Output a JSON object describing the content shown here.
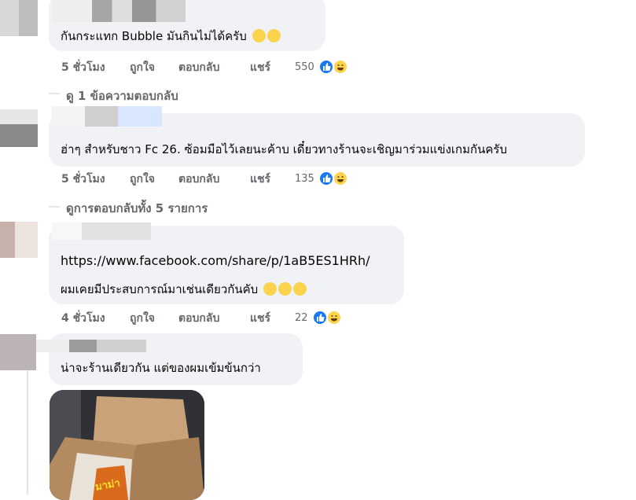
{
  "comments": [
    {
      "text": "กันกระแทก Bubble มันกินไม่ได้ครับ",
      "time": "5 ชั่วโมง",
      "reaction_count": "550"
    },
    {
      "text": "ฮ่าๆ สำหรับชาว Fc 26. ซ้อมมือไว้เลยนะค้าบ เดี๋ยวทางร้านจะเชิญมาร่วมแข่งเกมกันครับ",
      "time": "5 ชั่วโมง",
      "reaction_count": "135"
    },
    {
      "link": "https://www.facebook.com/share/p/1aB5ES1HRh/",
      "text": "ผมเคยมีประสบการณ์มาเช่นเดียวกันคับ",
      "time": "4 ชั่วโมง",
      "reaction_count": "22"
    },
    {
      "text": "น่าจะร้านเดียวกัน แต่ของผมเข้มข้นกว่า"
    }
  ],
  "actions": {
    "like": "ถูกใจ",
    "reply": "ตอบกลับ",
    "share": "แชร์"
  },
  "view_replies": [
    "ดู 1 ข้อความตอบกลับ",
    "ดูการตอบกลับทั้ง 5 รายการ"
  ],
  "photo_label": "มาม่า",
  "colors": {
    "bubble": "#f0f2f5",
    "meta_text": "#65676b",
    "like_blue": "#1877f2",
    "link": "#050505"
  }
}
